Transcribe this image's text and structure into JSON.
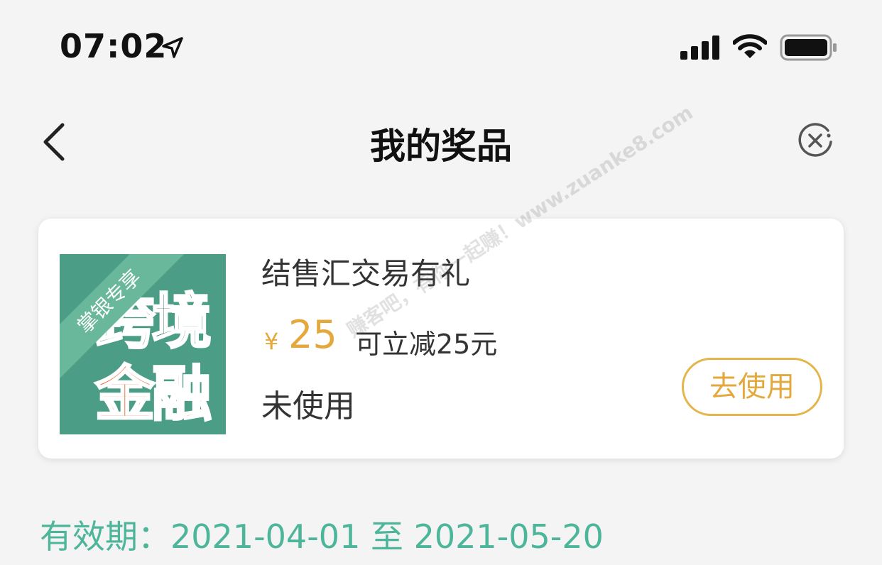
{
  "status_bar": {
    "time": "07:02",
    "icons": [
      "location-arrow-icon",
      "signal-icon",
      "wifi-icon",
      "battery-icon"
    ]
  },
  "nav": {
    "title": "我的奖品",
    "back_icon": "chevron-left-icon",
    "close_icon": "close-circle-icon"
  },
  "prize": {
    "thumb": {
      "ribbon": "掌银专享",
      "line1": "跨境",
      "line2": "金融"
    },
    "name": "结售汇交易有礼",
    "currency": "¥",
    "amount": "25",
    "discount": "可立减25元",
    "status": "未使用",
    "use_button": "去使用"
  },
  "watermark": "赚客吧，有你一起赚！www.zuanke8.com",
  "validity": "有效期：2021-04-01 至 2021-05-20",
  "colors": {
    "accent_gold": "#e3a93c",
    "accent_green": "#4cb59a",
    "thumb_bg": "#4c9d86",
    "thumb_orange": "#e9733c"
  }
}
